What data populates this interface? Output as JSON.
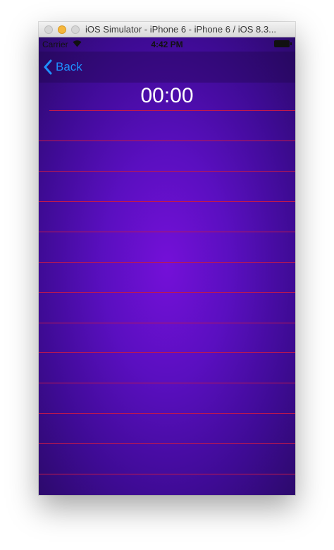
{
  "window": {
    "title": "iOS Simulator - iPhone 6 - iPhone 6 / iOS 8.3..."
  },
  "status_bar": {
    "carrier": "Carrier",
    "time": "4:42 PM",
    "wifi_icon": "wifi-icon",
    "battery_icon": "battery-icon"
  },
  "nav_bar": {
    "back_label": "Back",
    "back_icon": "chevron-left-icon"
  },
  "timer": {
    "value": "00:00"
  },
  "colors": {
    "accent": "#1e90ff",
    "separator": "#c2184a",
    "background_center": "#7410d8",
    "background_edge": "#2c0a6c"
  }
}
